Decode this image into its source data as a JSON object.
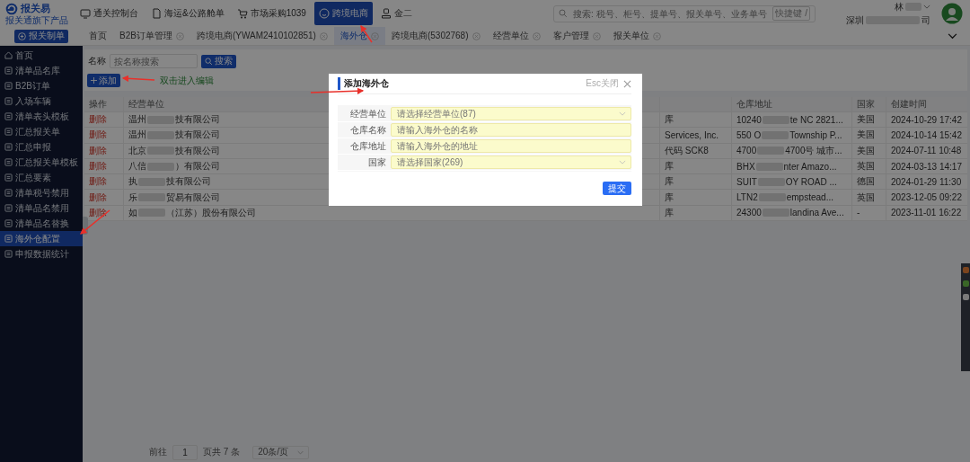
{
  "header": {
    "logo": {
      "name": "报关易",
      "tagline": "报关通旗下产品"
    },
    "nav": [
      {
        "label": "通关控制台",
        "selected": false
      },
      {
        "label": "海运&公路舱单",
        "selected": false
      },
      {
        "label": "市场采购1039",
        "selected": false
      },
      {
        "label": "跨境电商",
        "selected": true
      },
      {
        "label": "金二",
        "selected": false
      }
    ],
    "search": {
      "placeholder": "搜索: 税号、柜号、提单号、报关单号、业务单号",
      "shortcut": "快捷键 /"
    },
    "user": {
      "name": "林",
      "company_start": "深圳",
      "company_end": "司"
    }
  },
  "create_button": "报关制单",
  "tabs": [
    {
      "label": "首页",
      "selected": false,
      "closable": false
    },
    {
      "label": "B2B订单管理",
      "selected": false,
      "closable": true
    },
    {
      "label": "跨境电商(YWAM2410102851)",
      "selected": false,
      "closable": true
    },
    {
      "label": "海外仓",
      "selected": true,
      "closable": true
    },
    {
      "label": "跨境电商(5302768)",
      "selected": false,
      "closable": true
    },
    {
      "label": "经营单位",
      "selected": false,
      "closable": true
    },
    {
      "label": "客户管理",
      "selected": false,
      "closable": true
    },
    {
      "label": "报关单位",
      "selected": false,
      "closable": true
    }
  ],
  "sidebar": {
    "items": [
      {
        "label": "首页",
        "selected": false
      },
      {
        "label": "清单品名库",
        "selected": false
      },
      {
        "label": "B2B订单",
        "selected": false
      },
      {
        "label": "入场车辆",
        "selected": false
      },
      {
        "label": "清单表头模板",
        "selected": false
      },
      {
        "label": "汇总报关单",
        "selected": false
      },
      {
        "label": "汇总申报",
        "selected": false
      },
      {
        "label": "汇总报关单模板",
        "selected": false
      },
      {
        "label": "汇总要素",
        "selected": false
      },
      {
        "label": "清单税号禁用",
        "selected": false
      },
      {
        "label": "清单品名禁用",
        "selected": false
      },
      {
        "label": "清单品名替换",
        "selected": false
      },
      {
        "label": "海外仓配置",
        "selected": true
      },
      {
        "label": "申报数据统计",
        "selected": false
      }
    ]
  },
  "filter": {
    "label": "名称",
    "placeholder": "按名称搜索",
    "search_button": "搜索",
    "add_button": "添加",
    "hint": "双击进入编辑"
  },
  "table": {
    "columns": [
      "操作",
      "经营单位",
      "",
      "仓库地址",
      "国家",
      "创建时间"
    ],
    "rows": [
      {
        "action": "删除",
        "company": {
          "start": "温州",
          "end": "技有限公司"
        },
        "column_3": "库",
        "address": {
          "start": "10240",
          "end": "te NC 2821..."
        },
        "country": "美国",
        "created": "2024-10-29 17:42"
      },
      {
        "action": "删除",
        "company": {
          "start": "温州",
          "end": "技有限公司"
        },
        "column_3": "Services, Inc.",
        "address": {
          "start": "550 O",
          "end": "Township P..."
        },
        "country": "美国",
        "created": "2024-10-14 15:42"
      },
      {
        "action": "删除",
        "company": {
          "start": "北京",
          "end": "技有限公司"
        },
        "column_3": "代码 SCK8",
        "address": {
          "start": "4700",
          "end": "4700号 城市..."
        },
        "country": "美国",
        "created": "2024-07-11 10:48"
      },
      {
        "action": "删除",
        "company": {
          "start": "八信",
          "end": "）有限公司"
        },
        "column_3": "库",
        "address": {
          "start": "BHX",
          "end": "nter Amazo..."
        },
        "country": "英国",
        "created": "2024-03-13 14:17"
      },
      {
        "action": "删除",
        "company": {
          "start": "执",
          "end": "技有限公司"
        },
        "column_3": "库",
        "address": {
          "start": "SUIT",
          "end": "OY ROAD ..."
        },
        "country": "德国",
        "created": "2024-01-29 11:30"
      },
      {
        "action": "删除",
        "company": {
          "start": "乐",
          "end": "贸易有限公司"
        },
        "column_3": "库",
        "address": {
          "start": "LTN2",
          "end": "empstead..."
        },
        "country": "英国",
        "created": "2023-12-05 09:22"
      },
      {
        "action": "删除",
        "company": {
          "start": "如",
          "end": "（江苏）股份有限公司"
        },
        "column_3": "库",
        "address": {
          "start": "24300",
          "end": "landina Ave..."
        },
        "country": "-",
        "created": "2023-11-01 16:22"
      }
    ]
  },
  "pagination": {
    "goto": "前往",
    "page": "1",
    "total": "页共 7 条",
    "page_size": "20条/页"
  },
  "modal": {
    "title": "添加海外仓",
    "close_hint": "Esc关闭",
    "fields": [
      {
        "label": "经营单位",
        "placeholder": "请选择经营单位(87)",
        "kind": "select"
      },
      {
        "label": "仓库名称",
        "placeholder": "请输入海外仓的名称",
        "kind": "input"
      },
      {
        "label": "仓库地址",
        "placeholder": "请输入海外仓的地址",
        "kind": "input"
      },
      {
        "label": "国家",
        "placeholder": "请选择国家(269)",
        "kind": "select"
      }
    ],
    "submit": "提交"
  }
}
